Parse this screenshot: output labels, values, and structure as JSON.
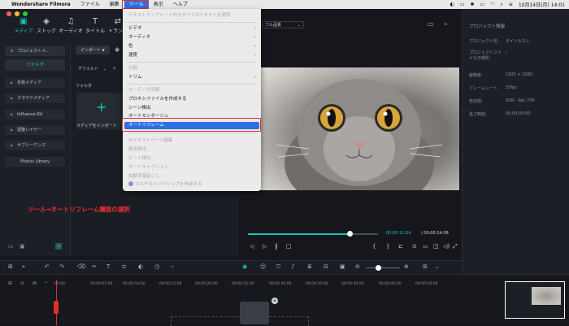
{
  "menubar": {
    "apple": "",
    "app_name": "Wondershare Filmora",
    "items": [
      "ファイル",
      "編集",
      "ツール",
      "表示",
      "ヘルプ"
    ],
    "active": "ツール",
    "datetime": "10月14日(月) 14:01"
  },
  "toolbar": {
    "buttons": [
      {
        "label": "メディア",
        "icon": "folder-icon"
      },
      {
        "label": "ストック",
        "icon": "stock-icon"
      },
      {
        "label": "オーディオ",
        "icon": "music-icon"
      },
      {
        "label": "タイトル",
        "icon": "text-icon"
      },
      {
        "label": "トランジ",
        "icon": "transition-icon"
      }
    ]
  },
  "sidebar": {
    "header": "プロジェクトメ...",
    "folder": "フォルダ",
    "items": [
      "共有メディア",
      "クラウドメディア",
      "Influence Kit",
      "調整レイヤー",
      "サブシーケンス",
      "Photos Library"
    ]
  },
  "media": {
    "import_label": "インポート",
    "sort_label": "デフォルト",
    "folder_label": "フォルダ",
    "import_tile_label": "メディアをインポート"
  },
  "preview": {
    "quality": "フル品質",
    "current_time": "00:00:11:04",
    "total_time": "/ 00:00:14:08",
    "progress": 0.78
  },
  "right_panel": {
    "header": "プロジェクト情報",
    "rows": [
      {
        "label": "プロジェクト名:",
        "value": "タイトルなし"
      },
      {
        "label": "プロジェクトファイルの場所:",
        "value": "/"
      },
      {
        "label": "解像度:",
        "value": "1920 × 1080"
      },
      {
        "label": "フレームレート:",
        "value": "25fps"
      },
      {
        "label": "色空間:",
        "value": "SDR - Rec.709"
      },
      {
        "label": "長さ時間:",
        "value": "00:00:00:00"
      }
    ]
  },
  "dropdown": {
    "items": [
      {
        "label": "テキストテンプレート内のすべてのテキストを選択",
        "disabled": true,
        "submenu": false
      },
      {
        "label": "ビデオ",
        "disabled": false,
        "submenu": true
      },
      {
        "label": "オーディオ",
        "disabled": false,
        "submenu": true
      },
      {
        "label": "色",
        "disabled": false,
        "submenu": true
      },
      {
        "label": "速度",
        "disabled": false,
        "submenu": true
      },
      {
        "label": "分割",
        "disabled": true,
        "submenu": false
      },
      {
        "label": "トリム",
        "disabled": false,
        "submenu": true
      },
      {
        "label": "オーディオ同期",
        "disabled": true,
        "submenu": false
      },
      {
        "label": "プロキシファイルを作成する",
        "disabled": false,
        "submenu": false
      },
      {
        "label": "シーン検出",
        "disabled": false,
        "submenu": false
      },
      {
        "label": "オートモンタージュ",
        "disabled": false,
        "submenu": false
      },
      {
        "label": "オートリフレーム",
        "disabled": false,
        "submenu": false,
        "highlighted": true
      },
      {
        "label": "AIテキストベース編集",
        "disabled": true,
        "submenu": false
      },
      {
        "label": "無音検出",
        "disabled": true,
        "submenu": false
      },
      {
        "label": "ビート検出",
        "disabled": true,
        "submenu": false
      },
      {
        "label": "オートキャプション",
        "disabled": true,
        "submenu": false
      },
      {
        "label": "自動字幕起こし",
        "disabled": true,
        "submenu": false
      },
      {
        "label": "マルチカメラクリップを作成する",
        "disabled": true,
        "submenu": false
      }
    ]
  },
  "annotation": "ツール→オートリフレーム機能の選択",
  "timeline": {
    "ticks": [
      "00:00",
      "00:00:05:00",
      "00:00:10:00",
      "00:00:15:00",
      "00:00:20:00",
      "00:00:25:00",
      "00:00:30:00",
      "00:00:35:00",
      "00:00:40:00",
      "00:00:45:00",
      "00:00:50:00"
    ]
  },
  "colors": {
    "accent": "#19c6c2",
    "highlight": "#2f6fe0",
    "annotation": "#f0302e"
  }
}
